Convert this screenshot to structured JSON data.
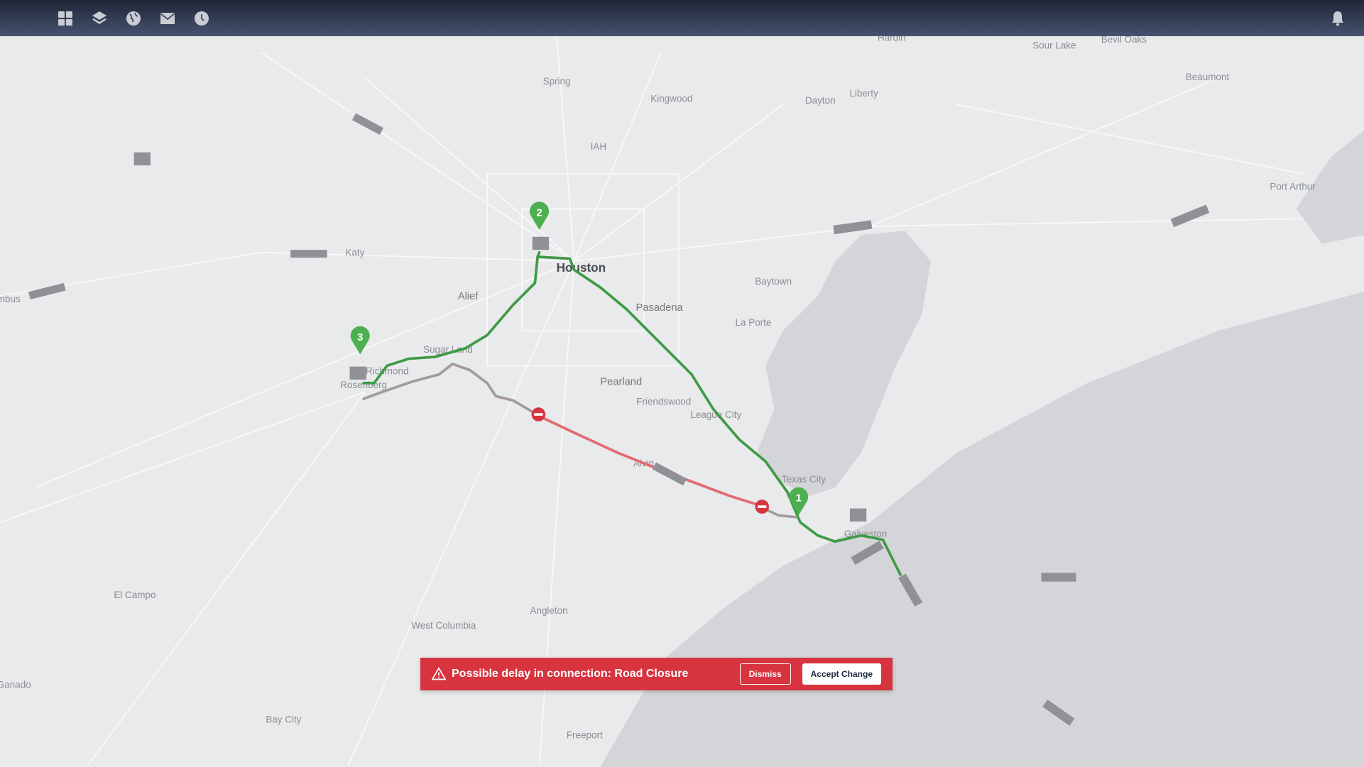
{
  "topbar": {
    "icons": [
      "grid-icon",
      "layers-icon",
      "globe-icon",
      "mail-icon",
      "clock-icon"
    ],
    "notification_icon": "bell-icon"
  },
  "map": {
    "labels": [
      "Spring",
      "Kingwood",
      "Dayton",
      "Liberty",
      "Sour Lake",
      "Bevil Oaks",
      "Hardin",
      "Beaumont",
      "Port Arthur",
      "IAH",
      "Katy",
      "Houston",
      "Alief",
      "Pasadena",
      "Baytown",
      "La Porte",
      "Sugar Land",
      "Richmond",
      "Rosenberg",
      "Pearland",
      "Friendswood",
      "League City",
      "Texas City",
      "Alvin",
      "Galveston",
      "El Campo",
      "West Columbia",
      "Angleton",
      "Freeport",
      "Bay City",
      "Ganado",
      "mbus"
    ],
    "markers": [
      "1",
      "2",
      "3"
    ],
    "colors": {
      "route_active": "#3f9a45",
      "route_delayed": "#e06b73",
      "route_inactive": "#a39a9c",
      "marker": "#4caf50",
      "closure": "#d7343f",
      "water": "#d3d5d8",
      "land": "#e9eaeb"
    }
  },
  "alert": {
    "icon": "warning-icon",
    "message": "Possible delay in connection: Road Closure",
    "dismiss_label": "Dismiss",
    "accept_label": "Accept Change",
    "color": "#d7343f"
  }
}
